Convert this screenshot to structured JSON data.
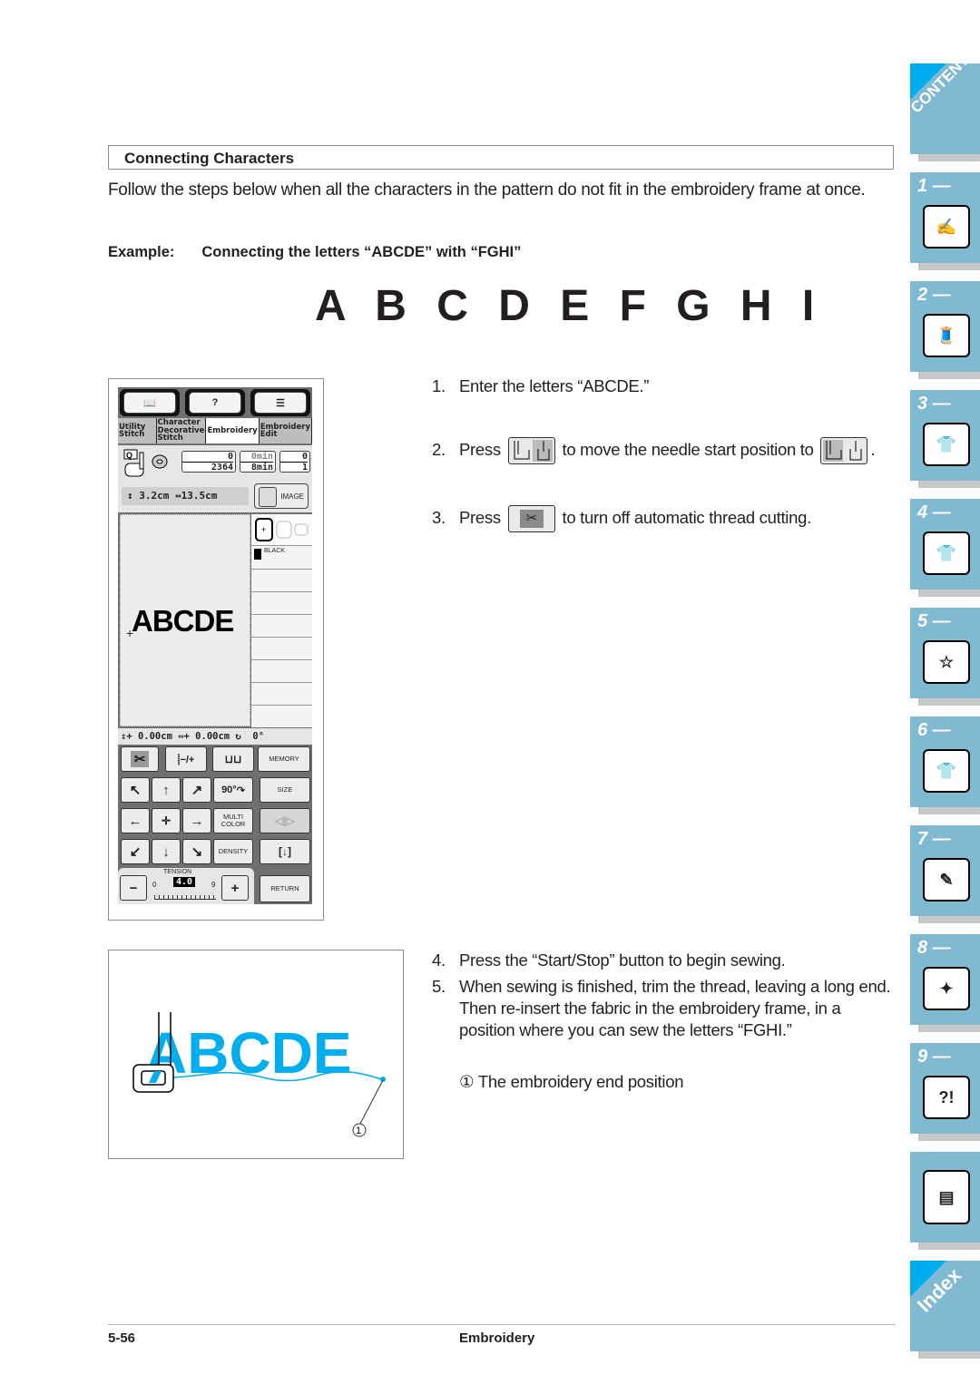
{
  "section": {
    "title": "Connecting Characters",
    "intro": "Follow the steps below when all the characters in the pattern do not fit in the embroidery frame at once.",
    "example_label": "Example:",
    "example_text": "Connecting the letters “ABCDE” with “FGHI”",
    "big_letters": "A B C D E F G H I"
  },
  "lcd": {
    "tabs": [
      "Utility Stitch",
      "Character Decorative Stitch",
      "Embroidery",
      "Embroidery Edit"
    ],
    "active_tab": "Embroidery",
    "stitch_count_top": "0",
    "stitch_count_total": "2364",
    "time_top": "0min",
    "time_total": "8min",
    "color_top": "0",
    "color_total": "1",
    "height": "3.2cm",
    "width": "13.5cm",
    "image_button": "IMAGE",
    "canvas_text": "ABCDE",
    "thread_color": "BLACK",
    "pos_readout": "⇕+ 0.00cm ⇔+ 0.00cm ↻  0°",
    "buttons": {
      "memory": "MEMORY",
      "rotate": "90°",
      "size": "SIZE",
      "multi_color": "MULTI COLOR",
      "density": "DENSITY",
      "tension_label": "TENSION",
      "tension_value": "4.0",
      "tension_min": "0",
      "tension_max": "9",
      "return": "RETURN",
      "minus": "−",
      "plus": "+"
    }
  },
  "steps": [
    {
      "num": "1.",
      "text": "Enter the letters “ABCDE.”"
    },
    {
      "num": "2.",
      "pre": "Press",
      "mid": "to move the needle start position to",
      "post": "."
    },
    {
      "num": "3.",
      "pre": "Press",
      "post": "to turn off automatic thread cutting."
    },
    {
      "num": "4.",
      "text": "Press the “Start/Stop” button to begin sewing."
    },
    {
      "num": "5.",
      "text": "When sewing is finished, trim the thread, leaving a long end. Then re-insert the fabric in the embroidery frame, in a position where you can sew the letters “FGHI.”"
    }
  ],
  "illustration": {
    "text": "ABCDE",
    "callout": "①",
    "accent": "#00aeef"
  },
  "legend": {
    "marker": "①",
    "text": "The embroidery end position"
  },
  "side_tabs": [
    {
      "label": "CONTENTS"
    },
    {
      "label": "1 —"
    },
    {
      "label": "2 —"
    },
    {
      "label": "3 —"
    },
    {
      "label": "4 —"
    },
    {
      "label": "5 —"
    },
    {
      "label": "6 —"
    },
    {
      "label": "7 —"
    },
    {
      "label": "8 —"
    },
    {
      "label": "9 —"
    },
    {
      "label": ""
    },
    {
      "label": "Index"
    }
  ],
  "side_tab_color": "#7fb9d2",
  "footer": {
    "page": "5-56",
    "title": "Embroidery"
  }
}
